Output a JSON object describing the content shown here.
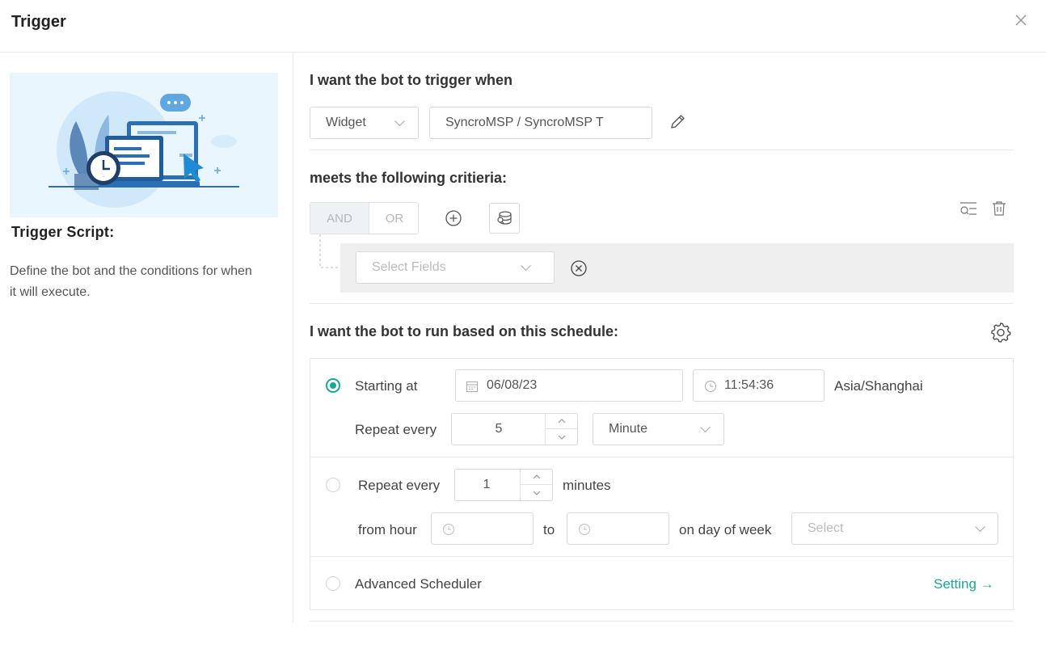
{
  "dialog": {
    "title": "Trigger"
  },
  "sidebar": {
    "heading": "Trigger Script:",
    "description": "Define the bot and the conditions for when it will execute."
  },
  "trigger_section": {
    "title": "I want the bot to trigger when",
    "source_select": "Widget",
    "source_value": "SyncroMSP / SyncroMSP T"
  },
  "criteria_section": {
    "title": "meets the following critieria:",
    "and_label": "AND",
    "or_label": "OR",
    "field_placeholder": "Select Fields"
  },
  "schedule_section": {
    "title": "I want the bot to run based on this schedule:",
    "option1": {
      "starting_label": "Starting at",
      "date": "06/08/23",
      "time": "11:54:36",
      "timezone": "Asia/Shanghai",
      "repeat_label": "Repeat every",
      "repeat_value": "5",
      "unit": "Minute"
    },
    "option2": {
      "repeat_label": "Repeat every",
      "repeat_value": "1",
      "unit_label": "minutes",
      "from_label": "from hour",
      "to_label": "to",
      "dow_label": "on day of week",
      "dow_placeholder": "Select"
    },
    "option3": {
      "label": "Advanced Scheduler",
      "setting_link": "Setting →"
    }
  },
  "colors": {
    "accent": "#18a89a",
    "illustration_bg": "#eaf6fd",
    "condition_bg": "#efefef"
  }
}
